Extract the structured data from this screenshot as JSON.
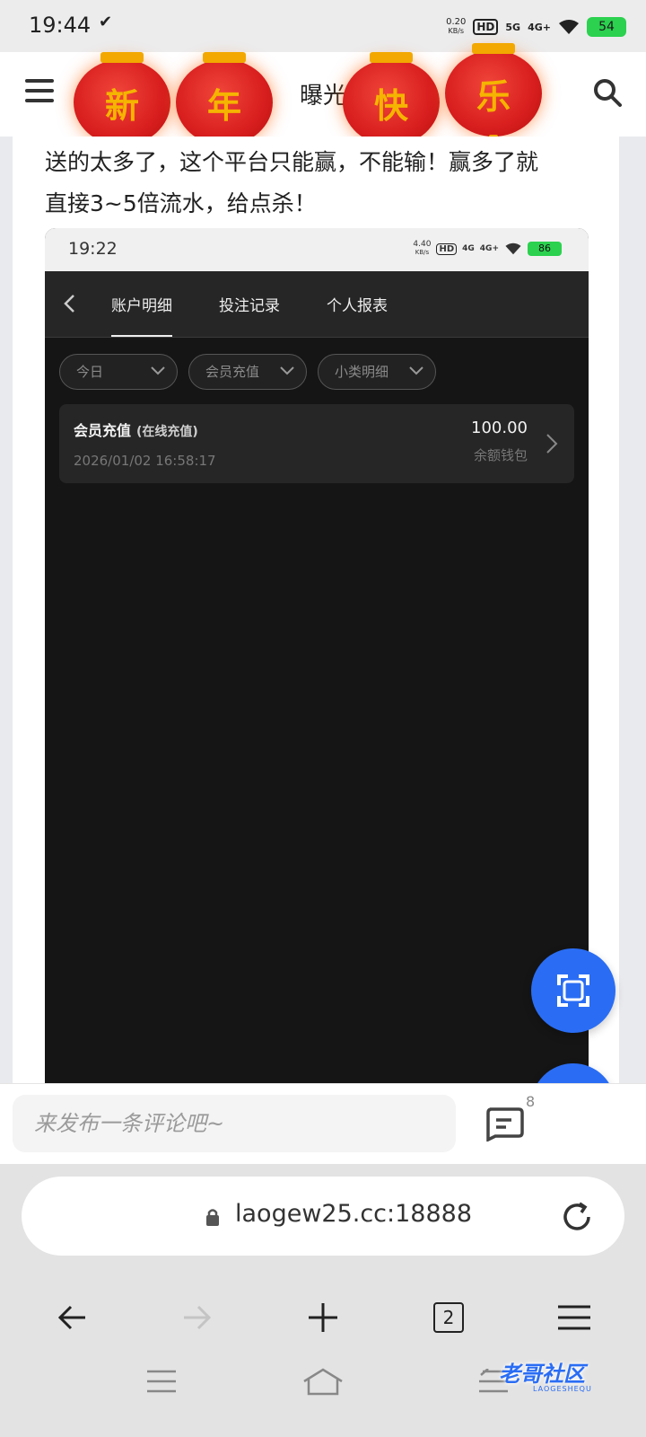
{
  "status_bar": {
    "time": "19:44",
    "net_speed": "0.20",
    "net_unit": "KB/s",
    "hd": "HD",
    "sig1": "5G",
    "sig2": "4G+",
    "battery": "54"
  },
  "header": {
    "title": "曝光",
    "lanterns": [
      "新",
      "年",
      "快",
      "乐"
    ]
  },
  "post": {
    "text_line1": "送的太多了，这个平台只能赢，不能输！赢多了就",
    "text_line2": "直接3~5倍流水，给点杀！"
  },
  "embedded_screenshot": {
    "status_time": "19:22",
    "net_speed": "4.40",
    "net_unit": "KB/s",
    "sig1": "4G",
    "sig2": "4G+",
    "battery": "86",
    "tabs": [
      {
        "label": "账户明细",
        "active": true
      },
      {
        "label": "投注记录",
        "active": false
      },
      {
        "label": "个人报表",
        "active": false
      }
    ],
    "filters": [
      "今日",
      "会员充值",
      "小类明细"
    ],
    "record": {
      "title": "会员充值",
      "subtitle": "(在线充值)",
      "time": "2026/01/02 16:58:17",
      "amount": "100.00",
      "wallet": "余额钱包"
    }
  },
  "comment_bar": {
    "placeholder": "来发布一条评论吧~",
    "count": "8"
  },
  "browser": {
    "url": "laogew25.cc:18888",
    "tab_count": "2"
  },
  "watermark": {
    "text": "老哥社区",
    "sub": "LAOGESHEQU"
  },
  "colors": {
    "accent": "#2a6df4",
    "dark_bg": "#151515",
    "lantern_red": "#d81e1e",
    "lantern_gold": "#f2a800"
  }
}
